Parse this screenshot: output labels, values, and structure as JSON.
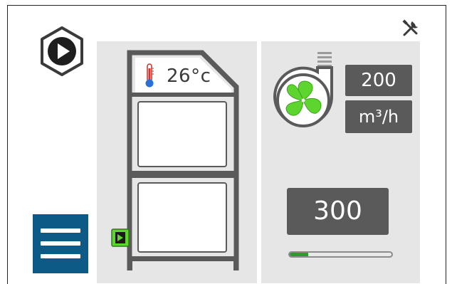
{
  "header": {
    "play_icon": "play-icon",
    "settings_icon": "wrench-screwdriver-icon"
  },
  "cabinet": {
    "temperature": "26°c",
    "thermometer_icon": "thermometer-icon",
    "door_button_icon": "play-arrow-icon"
  },
  "fan": {
    "icon": "fan-icon",
    "airflow_value": "200",
    "airflow_unit": "m³/h",
    "setpoint": "300",
    "progress": 0.18
  },
  "menu": {
    "icon": "hamburger-menu-icon"
  },
  "colors": {
    "accent_blue": "#0e5a86",
    "fan_green": "#5ed42e",
    "chip_gray": "#5a5a5a",
    "panel_gray": "#e6e6e6",
    "progress_green": "#2e9b2e"
  }
}
